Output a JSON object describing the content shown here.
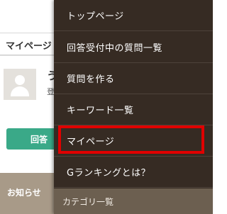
{
  "background": {
    "tab_label": "マイページ",
    "user_name": "う",
    "user_sub": "登",
    "answer_button_label": "回答",
    "notice_label": "お知らせ"
  },
  "menu": {
    "items": [
      {
        "label": "トップページ"
      },
      {
        "label": "回答受付中の質問一覧"
      },
      {
        "label": "質問を作る"
      },
      {
        "label": "キーワード一覧"
      },
      {
        "label": "マイページ",
        "highlighted": true
      },
      {
        "label": "Gランキングとは？"
      }
    ],
    "category_header": "カテゴリ一覧"
  },
  "colors": {
    "drawer_bg": "#362b23",
    "highlight_border": "#e00000",
    "answer_button": "#3aa988",
    "notice_bar": "#a89a88",
    "category_bg": "#6c5f50"
  }
}
